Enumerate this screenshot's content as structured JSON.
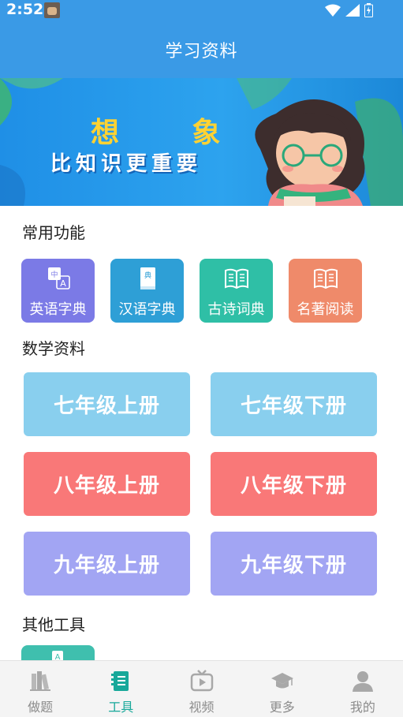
{
  "status_bar": {
    "time": "2:52"
  },
  "app_bar": {
    "title": "学习资料"
  },
  "banner": {
    "headline": "想 象",
    "subline": "比知识更重要"
  },
  "common_functions": {
    "title": "常用功能",
    "items": [
      {
        "label": "英语字典",
        "icon": "translate-icon",
        "color": "#7b7ae6"
      },
      {
        "label": "汉语字典",
        "icon": "dictionary-book-icon",
        "color": "#2e9fd6"
      },
      {
        "label": "古诗词典",
        "icon": "open-book-icon",
        "color": "#2fbfa6"
      },
      {
        "label": "名著阅读",
        "icon": "open-book-icon",
        "color": "#ef8a6a"
      }
    ]
  },
  "math_materials": {
    "title": "数学资料",
    "grades": [
      {
        "label": "七年级上册",
        "color": "#89cfee"
      },
      {
        "label": "七年级下册",
        "color": "#89cfee"
      },
      {
        "label": "八年级上册",
        "color": "#f97878"
      },
      {
        "label": "八年级下册",
        "color": "#f97878"
      },
      {
        "label": "九年级上册",
        "color": "#a2a5f3"
      },
      {
        "label": "九年级下册",
        "color": "#a2a5f3"
      }
    ]
  },
  "other_tools": {
    "title": "其他工具"
  },
  "tab_bar": {
    "active": "工具",
    "tabs": [
      {
        "label": "做题",
        "icon": "books-icon"
      },
      {
        "label": "工具",
        "icon": "notebook-icon"
      },
      {
        "label": "视频",
        "icon": "tv-icon"
      },
      {
        "label": "更多",
        "icon": "graduation-cap-icon"
      },
      {
        "label": "我的",
        "icon": "person-icon"
      }
    ]
  },
  "colors": {
    "primary": "#3a9ae6",
    "tab_active": "#18a89a",
    "tab_inactive": "#8c8c8c"
  }
}
